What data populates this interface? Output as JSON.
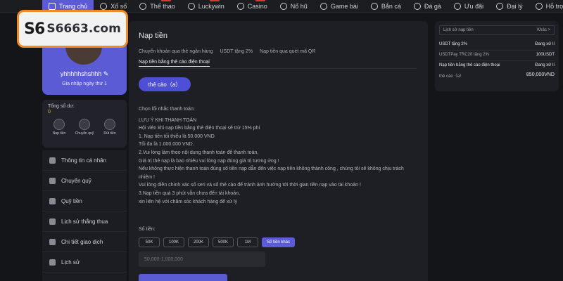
{
  "nav": [
    {
      "label": "Trang chủ",
      "icon": "home-icon",
      "active": true
    },
    {
      "label": "Xổ số",
      "icon": "lottery-icon"
    },
    {
      "label": "Thể thao",
      "icon": "sports-icon",
      "hot": true
    },
    {
      "label": "Luckywin",
      "icon": "luckywin-icon",
      "hot": true
    },
    {
      "label": "Casino",
      "icon": "casino-icon",
      "hot": true
    },
    {
      "label": "Nổ hũ",
      "icon": "slots-icon"
    },
    {
      "label": "Game bài",
      "icon": "cards-icon"
    },
    {
      "label": "Bắn cá",
      "icon": "fish-icon"
    },
    {
      "label": "Đá gà",
      "icon": "rooster-icon"
    },
    {
      "label": "Ưu đãi",
      "icon": "gift-icon"
    },
    {
      "label": "Đại lý",
      "icon": "agent-icon"
    },
    {
      "label": "Hỗ trợ",
      "icon": "support-icon"
    }
  ],
  "logo": {
    "mark": "S6",
    "text": "S6663.com"
  },
  "profile": {
    "username": "yhhhhhshshhh",
    "joined": "Gia nhập ngày thứ 1"
  },
  "wallet": {
    "label": "Tổng số dư:",
    "balance": "0",
    "actions": [
      "Nạp tiền",
      "Chuyển quỹ",
      "Rút tiền"
    ]
  },
  "menu": [
    "Thông tin cá nhân",
    "Chuyển quỹ",
    "Quỹ tiền",
    "Lịch sử thắng thua",
    "Chi tiết giao dịch",
    "Lịch sử"
  ],
  "main": {
    "title": "Nạp tiền",
    "tabs": [
      "Chuyển khoản qua thẻ ngân hàng",
      "USDT tặng 2%",
      "Nạp tiền qua quét mã QR"
    ],
    "active_tab": "Nạp tiền bằng thẻ cào điện thoại",
    "card_button": "thẻ cào（a）",
    "notes": [
      "Chọn lối nhắc thanh toán:",
      "LƯU Ý KHI THANH TOÁN",
      "Hội viên khi nạp tiền bằng thẻ điện thoại sẽ trừ 15% phí",
      "1. Nạp tiền tối thiểu là 50.000 VND",
      "Tối đa là 1.000.000 VND.",
      "2.Vui lòng làm theo nội dung thanh toán để thanh toán,",
      "Giá trị thẻ nạp là bao nhiêu vui lòng nạp đúng giá trị tương ứng !",
      "Nếu không thực hiện thanh toán đúng số tiền nạp dẫn đến việc nạp tiền không thành công , chúng tôi sẽ không chịu trách",
      "nhiệm !",
      "Vui lòng điền chính xác số seri và số thẻ cào để tránh ảnh hưởng tới thời gian tiền nạp vào tài khoản !",
      "3.Nạp tiền quá 3 phút vẫn chưa đến tài khoản,",
      "xin liên hệ với chăm sóc khách hàng để xử lý"
    ],
    "amount_label": "Số tiền:",
    "chips": [
      "50K",
      "100K",
      "200K",
      "500K",
      "1M",
      "Số tiền khác"
    ],
    "amount_placeholder": "50,000-1,000,000"
  },
  "history": {
    "title": "Lịch sử nạp tiền",
    "more": "Khác >",
    "rows": [
      {
        "a": "USDT tặng 2%",
        "b": "Đang xử lí"
      },
      {
        "a": "USDTPay TRC20 tặng 2%",
        "b": "100USDT"
      },
      {
        "a": "Nạp tiền bằng thẻ cào điện thoại",
        "b": "Đang xử lí"
      },
      {
        "a": "thẻ cào（a）",
        "b": "850,000VND"
      }
    ]
  },
  "colors": {
    "accent": "#5b5bd6",
    "logo_border": "#f08a24",
    "background": "#141518"
  }
}
